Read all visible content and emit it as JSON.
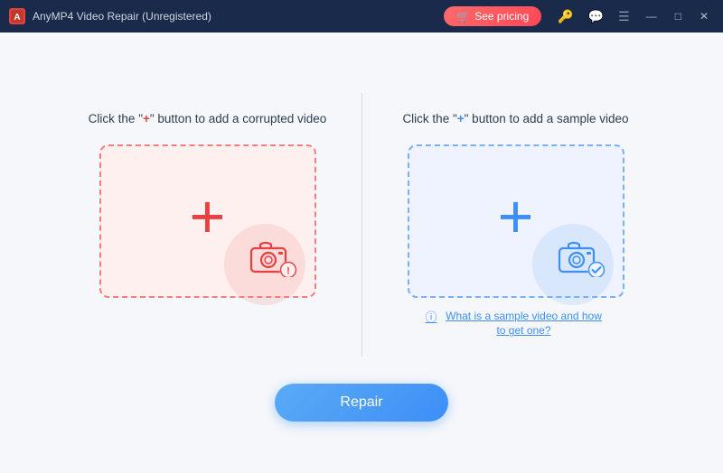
{
  "titlebar": {
    "app_icon_text": "A",
    "title": "AnyMP4 Video Repair (Unregistered)",
    "see_pricing_label": "See pricing",
    "icon_key": "🔑",
    "icon_chat": "💬",
    "icon_menu": "☰",
    "icon_min": "—",
    "icon_max": "□",
    "icon_close": "✕"
  },
  "left_panel": {
    "label_pre": "Click the \"",
    "label_plus": "+",
    "label_post": "\" button to add a corrupted video",
    "plus_symbol": "+"
  },
  "right_panel": {
    "label_pre": "Click the \"",
    "label_plus": "+",
    "label_post": "\" button to add a sample video",
    "plus_symbol": "+",
    "help_text": "What is a sample video and how to get one?"
  },
  "repair_button": {
    "label": "Repair"
  }
}
